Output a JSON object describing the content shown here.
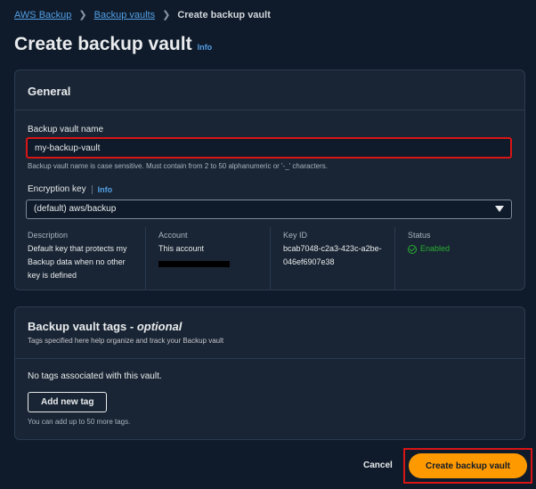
{
  "breadcrumb": [
    {
      "label": "AWS Backup"
    },
    {
      "label": "Backup vaults"
    },
    {
      "label": "Create backup vault"
    }
  ],
  "page_title": "Create backup vault",
  "info_label": "Info",
  "general": {
    "heading": "General",
    "vault_name_label": "Backup vault name",
    "vault_name_value": "my-backup-vault",
    "vault_name_hint": "Backup vault name is case sensitive. Must contain from 2 to 50 alphanumeric or '-_' characters.",
    "encryption_label": "Encryption key",
    "encryption_info": "Info",
    "encryption_selected": "(default) aws/backup",
    "details": {
      "description_title": "Description",
      "description_value": "Default key that protects my Backup data when no other key is defined",
      "account_title": "Account",
      "account_value": "This account",
      "key_id_title": "Key ID",
      "key_id_value": "bcab7048-c2a3-423c-a2be-046ef6907e38",
      "status_title": "Status",
      "status_value": "Enabled"
    }
  },
  "tags": {
    "heading_main": "Backup vault tags - ",
    "heading_optional": "optional",
    "description": "Tags specified here help organize and track your Backup vault",
    "empty_text": "No tags associated with this vault.",
    "add_button": "Add new tag",
    "hint": "You can add up to 50 more tags."
  },
  "footer": {
    "cancel": "Cancel",
    "create": "Create backup vault"
  },
  "colors": {
    "background": "#0f1b2a",
    "panel": "#192534",
    "link": "#539fe5",
    "primary": "#ff9900",
    "success": "#29ad32",
    "highlight": "#d91515"
  }
}
